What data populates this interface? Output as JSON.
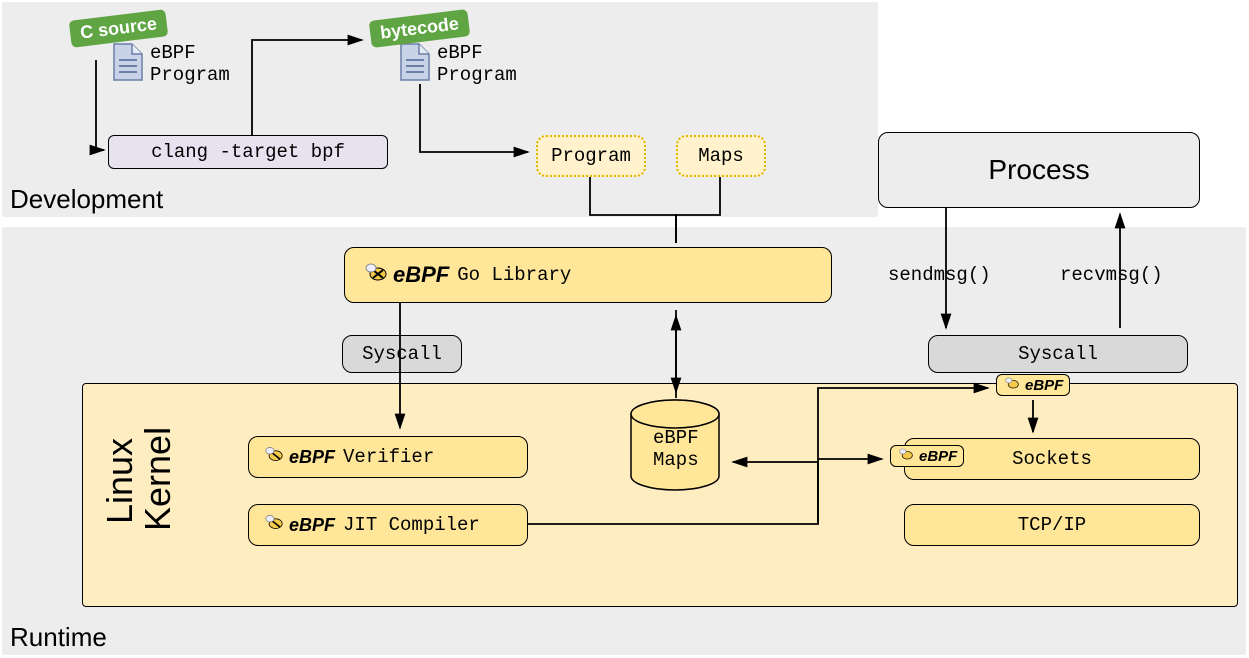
{
  "sections": {
    "development": "Development",
    "runtime": "Runtime",
    "kernel_l1": "Linux",
    "kernel_l2": "Kernel"
  },
  "tags": {
    "csource": "C source",
    "bytecode": "bytecode"
  },
  "ebpf_text": "eBPF",
  "programs": {
    "ebpf_program_l1": "eBPF",
    "ebpf_program_l2": "Program"
  },
  "boxes": {
    "clang": "clang -target bpf",
    "program": "Program",
    "maps": "Maps",
    "golib": "Go Library",
    "syscall": "Syscall",
    "verifier": "Verifier",
    "jit": "JIT Compiler",
    "ebpf_maps_l1": "eBPF",
    "ebpf_maps_l2": "Maps",
    "process": "Process",
    "sockets": "Sockets",
    "tcpip": "TCP/IP"
  },
  "labels": {
    "sendmsg": "sendmsg()",
    "recvmsg": "recvmsg()"
  },
  "colors": {
    "yellow": "#ffe699",
    "lightyellow": "#fff2cc",
    "grey": "#d9d9d9",
    "lilac": "#e8e2f0",
    "green": "#5fa544"
  }
}
